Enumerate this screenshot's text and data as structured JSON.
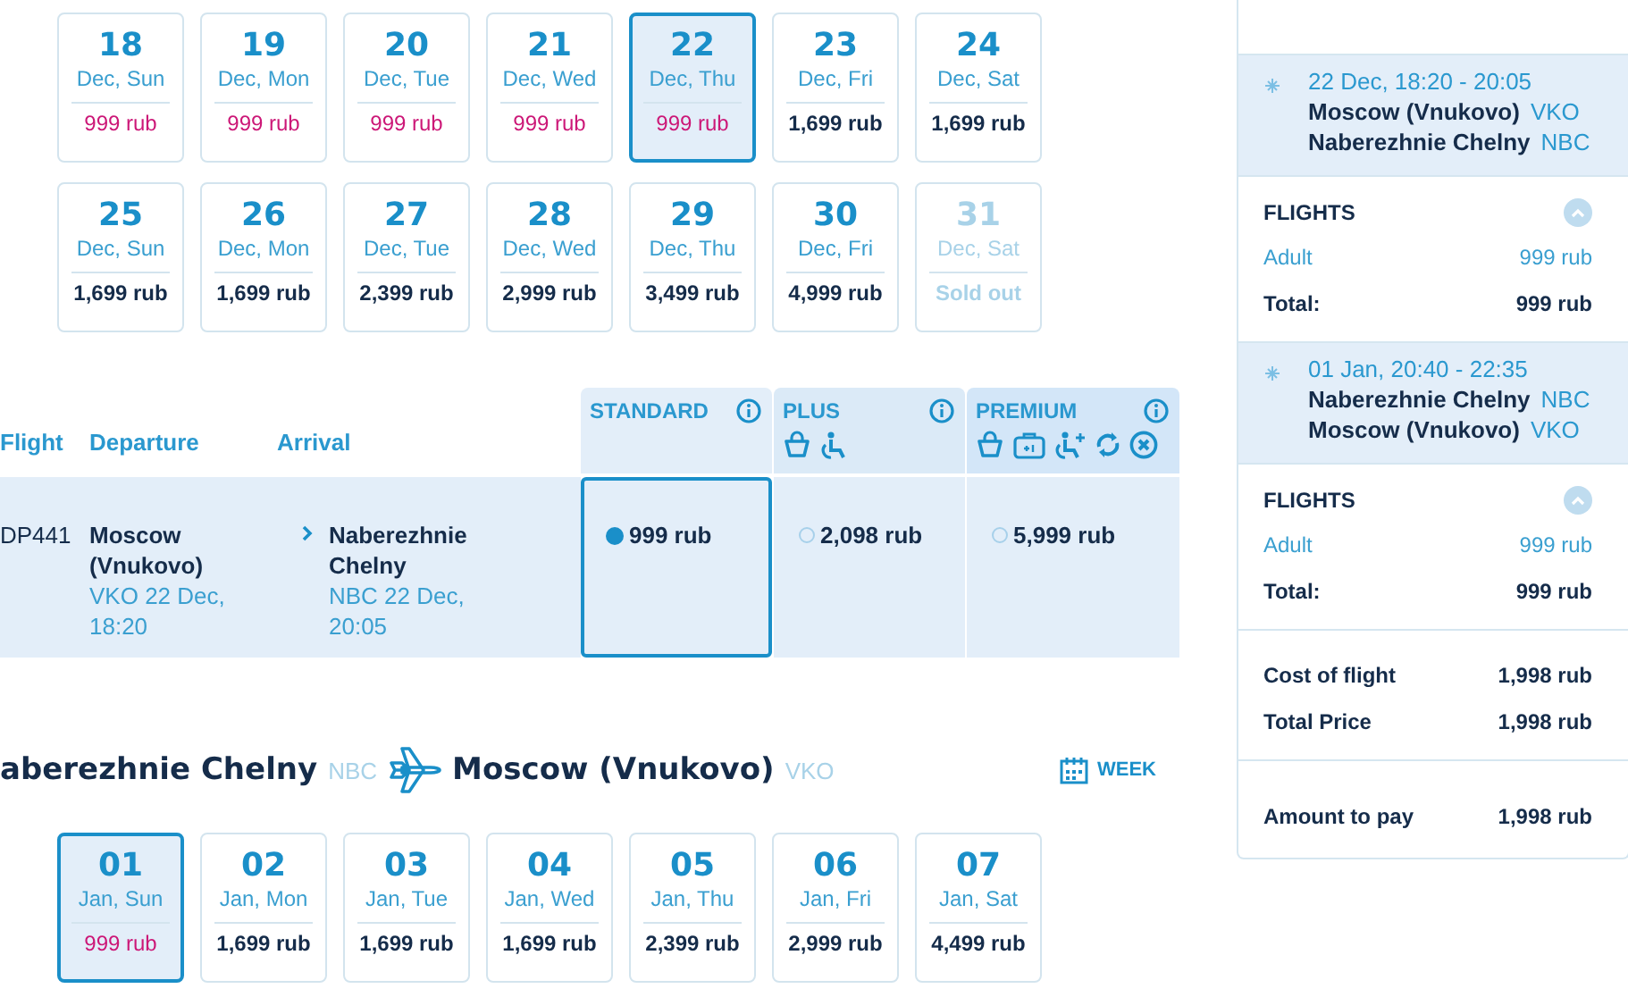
{
  "outbound_dates": [
    {
      "day": "18",
      "label": "Dec, Sun",
      "price": "999 rub",
      "lowest": true,
      "selected": false,
      "available": true
    },
    {
      "day": "19",
      "label": "Dec, Mon",
      "price": "999 rub",
      "lowest": true,
      "selected": false,
      "available": true
    },
    {
      "day": "20",
      "label": "Dec, Tue",
      "price": "999 rub",
      "lowest": true,
      "selected": false,
      "available": true
    },
    {
      "day": "21",
      "label": "Dec, Wed",
      "price": "999 rub",
      "lowest": true,
      "selected": false,
      "available": true
    },
    {
      "day": "22",
      "label": "Dec, Thu",
      "price": "999 rub",
      "lowest": true,
      "selected": true,
      "available": true
    },
    {
      "day": "23",
      "label": "Dec, Fri",
      "price": "1,699 rub",
      "lowest": false,
      "selected": false,
      "available": true
    },
    {
      "day": "24",
      "label": "Dec, Sat",
      "price": "1,699 rub",
      "lowest": false,
      "selected": false,
      "available": true
    },
    {
      "day": "25",
      "label": "Dec, Sun",
      "price": "1,699 rub",
      "lowest": false,
      "selected": false,
      "available": true
    },
    {
      "day": "26",
      "label": "Dec, Mon",
      "price": "1,699 rub",
      "lowest": false,
      "selected": false,
      "available": true
    },
    {
      "day": "27",
      "label": "Dec, Tue",
      "price": "2,399 rub",
      "lowest": false,
      "selected": false,
      "available": true
    },
    {
      "day": "28",
      "label": "Dec, Wed",
      "price": "2,999 rub",
      "lowest": false,
      "selected": false,
      "available": true
    },
    {
      "day": "29",
      "label": "Dec, Thu",
      "price": "3,499 rub",
      "lowest": false,
      "selected": false,
      "available": true
    },
    {
      "day": "30",
      "label": "Dec, Fri",
      "price": "4,999 rub",
      "lowest": false,
      "selected": false,
      "available": true
    },
    {
      "day": "31",
      "label": "Dec, Sat",
      "price": "Sold out",
      "lowest": false,
      "selected": false,
      "available": false
    }
  ],
  "fare_table": {
    "columns": [
      "Flight",
      "Departure",
      "Arrival"
    ],
    "fare_classes": [
      {
        "name": "STANDARD",
        "kind": "standard"
      },
      {
        "name": "PLUS",
        "kind": "plus"
      },
      {
        "name": "PREMIUM",
        "kind": "premium"
      }
    ],
    "flights": [
      {
        "number": "DP441",
        "from_city": "Moscow (Vnukovo)",
        "from_detail": "VKO 22 Dec, 18:20",
        "to_city": "Naberezhnie Chelny",
        "to_detail": "NBC 22 Dec, 20:05",
        "fares": [
          {
            "price": "999 rub",
            "selected": true
          },
          {
            "price": "2,098 rub",
            "selected": false
          },
          {
            "price": "5,999 rub",
            "selected": false
          }
        ]
      }
    ]
  },
  "return_route": {
    "from": "aberezhnie Chelny",
    "from_code": "NBC",
    "to": "Moscow (Vnukovo)",
    "to_code": "VKO",
    "view_button": "WEEK"
  },
  "return_dates": [
    {
      "day": "01",
      "label": "Jan, Sun",
      "price": "999 rub",
      "lowest": true,
      "selected": true,
      "available": true
    },
    {
      "day": "02",
      "label": "Jan, Mon",
      "price": "1,699 rub",
      "lowest": false,
      "selected": false,
      "available": true
    },
    {
      "day": "03",
      "label": "Jan, Tue",
      "price": "1,699 rub",
      "lowest": false,
      "selected": false,
      "available": true
    },
    {
      "day": "04",
      "label": "Jan, Wed",
      "price": "1,699 rub",
      "lowest": false,
      "selected": false,
      "available": true
    },
    {
      "day": "05",
      "label": "Jan, Thu",
      "price": "2,399 rub",
      "lowest": false,
      "selected": false,
      "available": true
    },
    {
      "day": "06",
      "label": "Jan, Fri",
      "price": "2,999 rub",
      "lowest": false,
      "selected": false,
      "available": true
    },
    {
      "day": "07",
      "label": "Jan, Sat",
      "price": "4,499 rub",
      "lowest": false,
      "selected": false,
      "available": true
    }
  ],
  "order": {
    "segments": [
      {
        "time": "22 Dec, 18:20 - 20:05",
        "from": "Moscow (Vnukovo)",
        "from_code": "VKO",
        "to": "Naberezhnie Chelny",
        "to_code": "NBC",
        "flights": {
          "title": "FLIGHTS",
          "expanded": true,
          "lines": [
            {
              "label": "Adult",
              "value": "999 rub"
            }
          ],
          "total_label": "Total:",
          "total": "999 rub"
        }
      },
      {
        "time": "01 Jan, 20:40 - 22:35",
        "from": "Naberezhnie Chelny",
        "from_code": "NBC",
        "to": "Moscow (Vnukovo)",
        "to_code": "VKO",
        "flights": {
          "title": "FLIGHTS",
          "expanded": true,
          "lines": [
            {
              "label": "Adult",
              "value": "999 rub"
            }
          ],
          "total_label": "Total:",
          "total": "999 rub"
        }
      }
    ],
    "summary": [
      {
        "label": "Cost of flight",
        "value": "1,998 rub"
      },
      {
        "label": "Total Price",
        "value": "1,998 rub"
      }
    ],
    "amount": {
      "label": "Amount to pay",
      "value": "1,998 rub"
    }
  }
}
